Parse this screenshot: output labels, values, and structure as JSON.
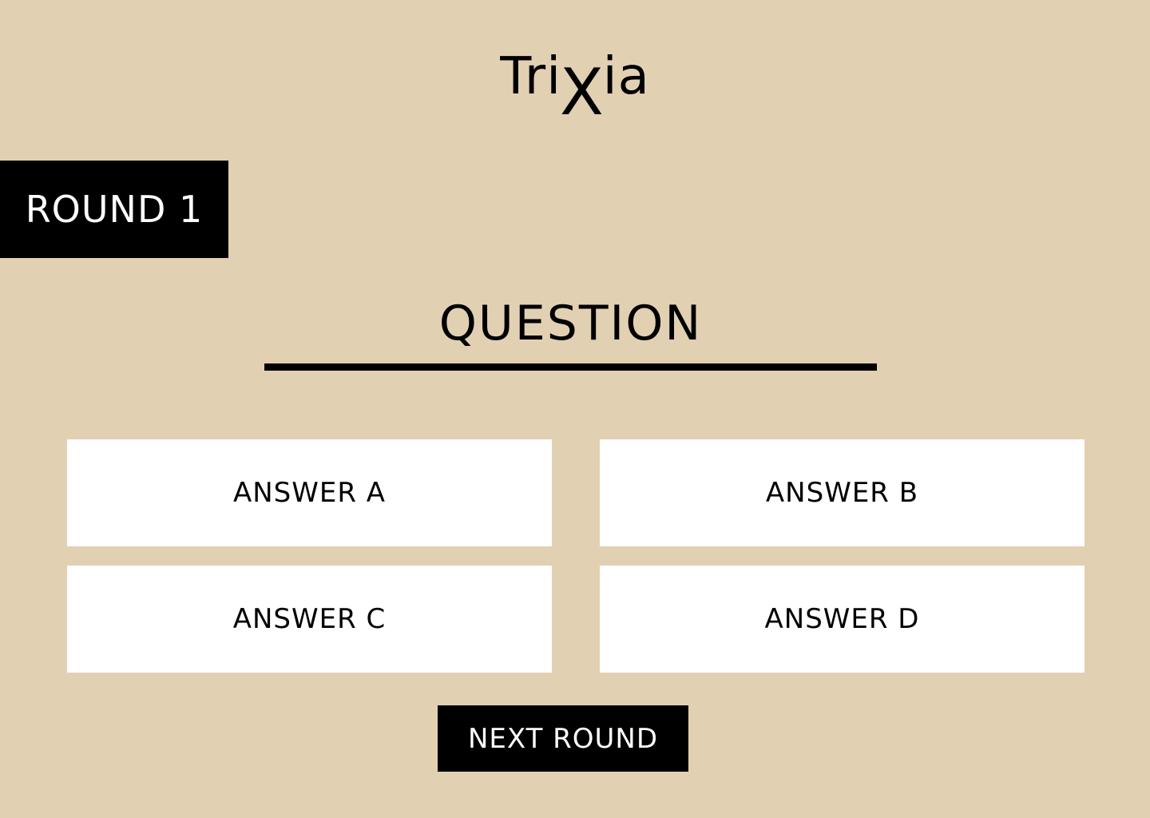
{
  "logo": {
    "prefix": "Tri",
    "x": "X",
    "suffix": "ia"
  },
  "round": {
    "label": "ROUND 1"
  },
  "question": {
    "text": "QUESTION"
  },
  "answers": [
    {
      "label": "ANSWER A"
    },
    {
      "label": "ANSWER B"
    },
    {
      "label": "ANSWER C"
    },
    {
      "label": "ANSWER D"
    }
  ],
  "next_button": {
    "label": "NEXT ROUND"
  },
  "colors": {
    "background": "#e2d0b3",
    "primary": "#000000",
    "card": "#ffffff"
  }
}
